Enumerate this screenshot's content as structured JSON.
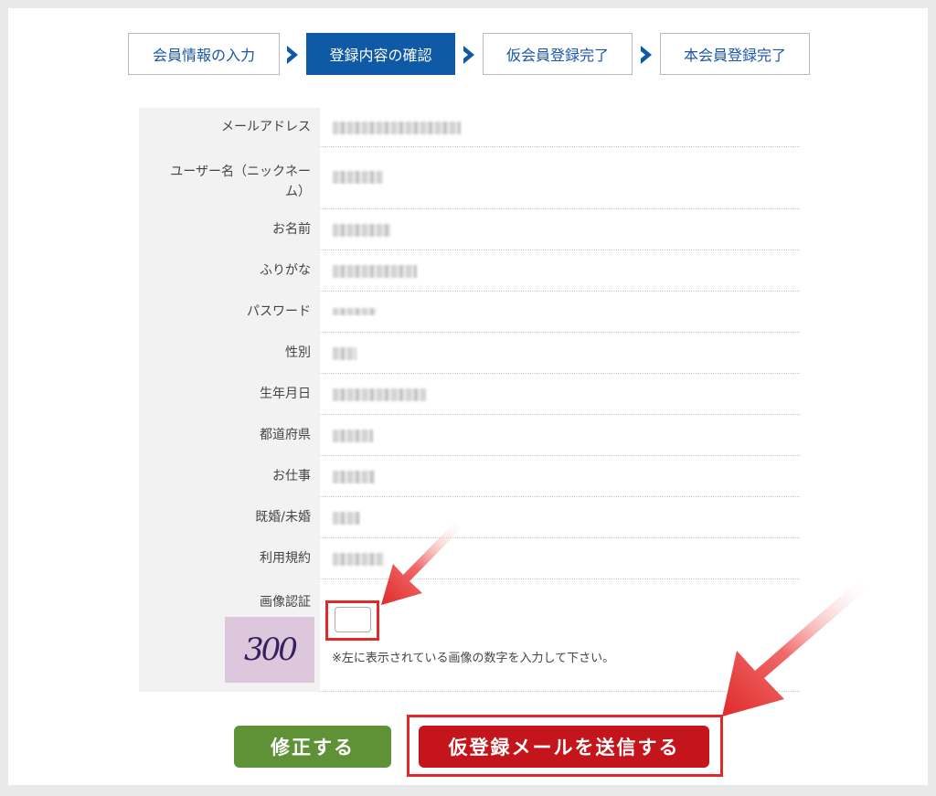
{
  "steps": [
    {
      "label": "会員情報の入力",
      "active": false
    },
    {
      "label": "登録内容の確認",
      "active": true
    },
    {
      "label": "仮会員登録完了",
      "active": false
    },
    {
      "label": "本会員登録完了",
      "active": false
    }
  ],
  "fields": {
    "email": "メールアドレス",
    "username_1": "ユーザー名（ニックネー",
    "username_2": "ム）",
    "name": "お名前",
    "furigana": "ふりがな",
    "password": "パスワード",
    "gender": "性別",
    "birthday": "生年月日",
    "prefecture": "都道府県",
    "job": "お仕事",
    "marital": "既婚/未婚",
    "terms": "利用規約",
    "captcha": "画像認証"
  },
  "captcha": {
    "image_text": "300",
    "input_value": "",
    "note": "※左に表示されている画像の数字を入力して下さい。"
  },
  "buttons": {
    "fix": "修正する",
    "send": "仮登録メールを送信する"
  },
  "colors": {
    "accent_blue": "#0f5aa7",
    "fix_green": "#5f9236",
    "send_red": "#c4141c",
    "highlight_red": "#e02a2a"
  }
}
